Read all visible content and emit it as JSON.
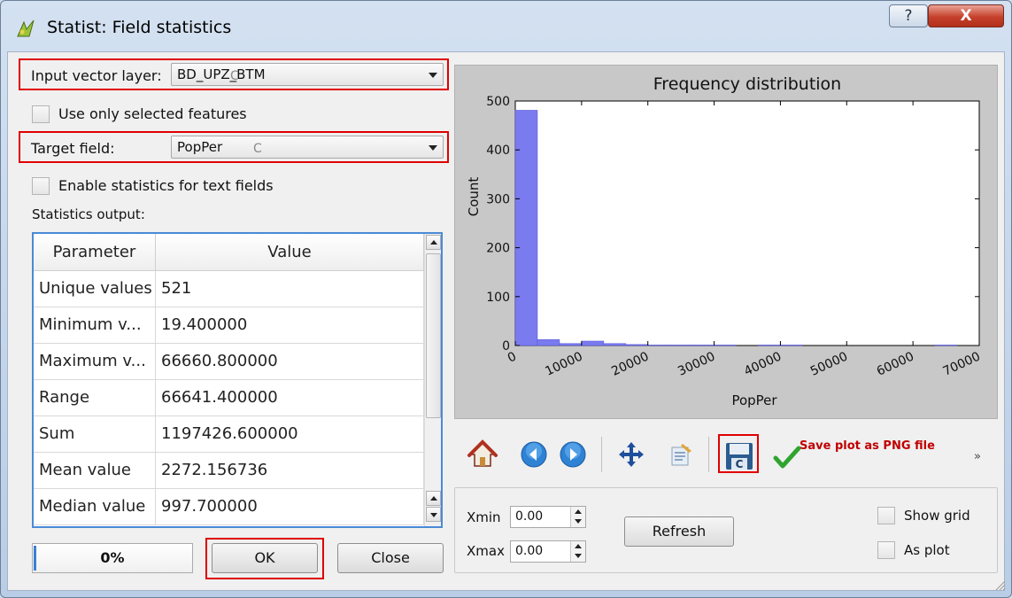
{
  "window": {
    "title": "Statist: Field statistics",
    "help_label": "?",
    "close_label": "X"
  },
  "input_layer": {
    "label": "Input vector layer:",
    "value": "BD_UPZ_BTM"
  },
  "use_selected": {
    "label": "Use only selected features",
    "checked": false
  },
  "target_field": {
    "label": "Target field:",
    "value": "PopPer"
  },
  "enable_text_stats": {
    "label": "Enable statistics for text fields",
    "checked": false
  },
  "stats_output": {
    "label": "Statistics output:",
    "columns": [
      "Parameter",
      "Value"
    ],
    "rows": [
      {
        "parameter": "Unique values",
        "value": "521"
      },
      {
        "parameter": "Minimum v...",
        "value": "19.400000"
      },
      {
        "parameter": "Maximum v...",
        "value": "66660.800000"
      },
      {
        "parameter": "Range",
        "value": "66641.400000"
      },
      {
        "parameter": "Sum",
        "value": "1197426.600000"
      },
      {
        "parameter": "Mean value",
        "value": "2272.156736"
      },
      {
        "parameter": "Median value",
        "value": "997.700000"
      }
    ]
  },
  "progress": {
    "text": "0%",
    "value": 0
  },
  "buttons": {
    "ok": "OK",
    "close": "Close",
    "refresh": "Refresh"
  },
  "cursor_marker": "C",
  "chart_data": {
    "type": "bar",
    "title": "Frequency distribution",
    "xlabel": "PopPer",
    "ylabel": "Count",
    "xlim": [
      0,
      70000
    ],
    "ylim": [
      0,
      500
    ],
    "xticks": [
      "0",
      "10000",
      "20000",
      "30000",
      "40000",
      "50000",
      "60000",
      "70000"
    ],
    "yticks": [
      "0",
      "100",
      "200",
      "300",
      "400",
      "500"
    ],
    "bin_width": 3333,
    "bins_start": [
      0,
      3333,
      6666,
      9999,
      13332,
      16665,
      19998,
      23331,
      26664,
      29997,
      33330,
      36663,
      39996,
      43329,
      46662,
      49995,
      53328,
      56661,
      59994,
      63327
    ],
    "values": [
      481,
      12,
      4,
      9,
      4,
      2,
      1,
      1,
      1,
      1,
      0,
      1,
      1,
      0,
      0,
      0,
      0,
      0,
      0,
      1
    ],
    "color": "#7b7bf0",
    "grid": false
  },
  "toolbar": {
    "icons": [
      "home-icon",
      "back-icon",
      "forward-icon",
      "pan-icon",
      "edit-axes-icon",
      "save-icon",
      "save-ok-icon"
    ],
    "save_hint": "Save plot as PNG file",
    "more": "»"
  },
  "axis_controls": {
    "xmin_label": "Xmin",
    "xmin_value": "0.00",
    "xmax_label": "Xmax",
    "xmax_value": "0.00",
    "show_grid_label": "Show grid",
    "as_plot_label": "As plot"
  },
  "colors": {
    "highlight": "#e00000",
    "bars": "#7b7bf0",
    "hint": "#c00000"
  }
}
